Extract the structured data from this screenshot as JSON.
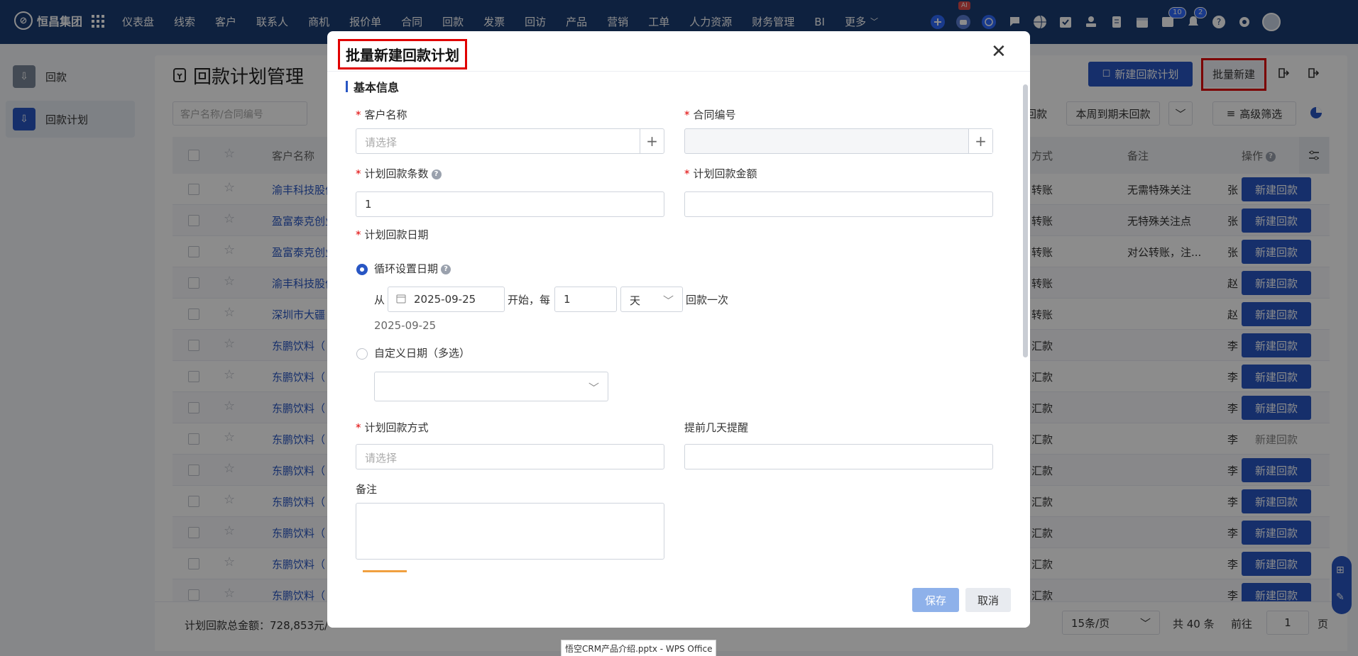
{
  "topnav": {
    "brand": "恒昌集团",
    "menu": [
      "仪表盘",
      "线索",
      "客户",
      "联系人",
      "商机",
      "报价单",
      "合同",
      "回款",
      "发票",
      "回访",
      "产品",
      "营销",
      "工单",
      "人力资源",
      "财务管理",
      "BI",
      "更多"
    ],
    "ai_badge": "AI",
    "messages_badge": "10",
    "notifications_badge": "2"
  },
  "sidebar": {
    "items": [
      {
        "label": "回款",
        "active": false
      },
      {
        "label": "回款计划",
        "active": true
      }
    ]
  },
  "page": {
    "title": "回款计划管理",
    "search_placeholder": "客户名称/合同编号",
    "new_plan_button": "新建回款计划",
    "batch_new_button": "批量新建",
    "quick_filter_1": "回款",
    "quick_filter_2": "本周到期未回款",
    "advanced_filter": "高级筛选"
  },
  "table": {
    "headers": {
      "customer": "客户名称",
      "method": "方式",
      "remark": "备注",
      "actions": "操作"
    },
    "rows": [
      {
        "customer": "渝丰科技股份",
        "method": "转账",
        "remark": "无需特殊关注",
        "owner": "张",
        "action": "新建回款",
        "enabled": true
      },
      {
        "customer": "盈富泰克创业",
        "method": "转账",
        "remark": "无特殊关注点",
        "owner": "张",
        "action": "新建回款",
        "enabled": true
      },
      {
        "customer": "盈富泰克创业",
        "method": "转账",
        "remark": "对公转账，注...",
        "owner": "张",
        "action": "新建回款",
        "enabled": true
      },
      {
        "customer": "渝丰科技股份",
        "method": "转账",
        "remark": "",
        "owner": "赵",
        "action": "新建回款",
        "enabled": true
      },
      {
        "customer": "深圳市大疆",
        "method": "转账",
        "remark": "",
        "owner": "赵",
        "action": "新建回款",
        "enabled": true
      },
      {
        "customer": "东鹏饮料（",
        "method": "汇款",
        "remark": "",
        "owner": "李",
        "action": "新建回款",
        "enabled": true
      },
      {
        "customer": "东鹏饮料（",
        "method": "汇款",
        "remark": "",
        "owner": "李",
        "action": "新建回款",
        "enabled": true
      },
      {
        "customer": "东鹏饮料（",
        "method": "汇款",
        "remark": "",
        "owner": "李",
        "action": "新建回款",
        "enabled": true
      },
      {
        "customer": "东鹏饮料（",
        "method": "汇款",
        "remark": "",
        "owner": "李",
        "action": "新建回款",
        "enabled": false
      },
      {
        "customer": "东鹏饮料（",
        "method": "汇款",
        "remark": "",
        "owner": "李",
        "action": "新建回款",
        "enabled": true
      },
      {
        "customer": "东鹏饮料（",
        "method": "汇款",
        "remark": "",
        "owner": "李",
        "action": "新建回款",
        "enabled": true
      },
      {
        "customer": "东鹏饮料（",
        "method": "汇款",
        "remark": "",
        "owner": "李",
        "action": "新建回款",
        "enabled": true
      },
      {
        "customer": "东鹏饮料（",
        "method": "汇款",
        "remark": "",
        "owner": "李",
        "action": "新建回款",
        "enabled": true
      },
      {
        "customer": "东鹏饮料（",
        "method": "汇款",
        "remark": "",
        "owner": "李",
        "action": "新建回款",
        "enabled": true
      }
    ]
  },
  "footer": {
    "total_amount": "计划回款总金额：728,853元/",
    "page_size": "15条/页",
    "total": "共 40 条",
    "goto_label": "前往",
    "goto_value": "1",
    "page_unit": "页"
  },
  "modal": {
    "title": "批量新建回款计划",
    "section_basic": "基本信息",
    "customer_label": "客户名称",
    "customer_placeholder": "请选择",
    "contract_label": "合同编号",
    "count_label": "计划回款条数",
    "count_value": "1",
    "amount_label": "计划回款金额",
    "date_label": "计划回款日期",
    "cycle_option": "循环设置日期",
    "from_label": "从",
    "start_date": "2025-09-25",
    "start_every": "开始，每",
    "interval_value": "1",
    "interval_unit": "天",
    "once_label": "回款一次",
    "preview_date": "2025-09-25",
    "custom_option": "自定义日期（多选）",
    "method_label": "计划回款方式",
    "method_placeholder": "请选择",
    "remind_label": "提前几天提醒",
    "remark_label": "备注",
    "save_button": "保存",
    "cancel_button": "取消"
  },
  "taskbar_tooltip": "悟空CRM产品介绍.pptx - WPS Office"
}
